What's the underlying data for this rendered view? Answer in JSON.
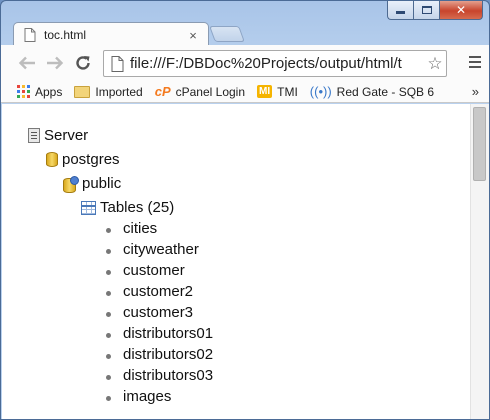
{
  "browser": {
    "tab_title": "toc.html",
    "tab_close": "×",
    "url": "file:///F:/DBDoc%20Projects/output/html/t"
  },
  "bookmarks": [
    {
      "label": "Apps",
      "icon": "apps-grid-icon"
    },
    {
      "label": "Imported",
      "icon": "folder-icon"
    },
    {
      "label": "cPanel Login",
      "icon": "cpanel-icon",
      "icon_text": "cP"
    },
    {
      "label": "TMI",
      "icon": "mi-icon",
      "icon_text": "MI"
    },
    {
      "label": "Red Gate - SQB 6",
      "icon": "broadcast-icon"
    }
  ],
  "bookmarks_more": "»",
  "tree": {
    "server": "Server",
    "database": "postgres",
    "schema": "public",
    "tables_label": "Tables (25)",
    "tables": [
      "cities",
      "cityweather",
      "customer",
      "customer2",
      "customer3",
      "distributors01",
      "distributors02",
      "distributors03",
      "images"
    ]
  }
}
